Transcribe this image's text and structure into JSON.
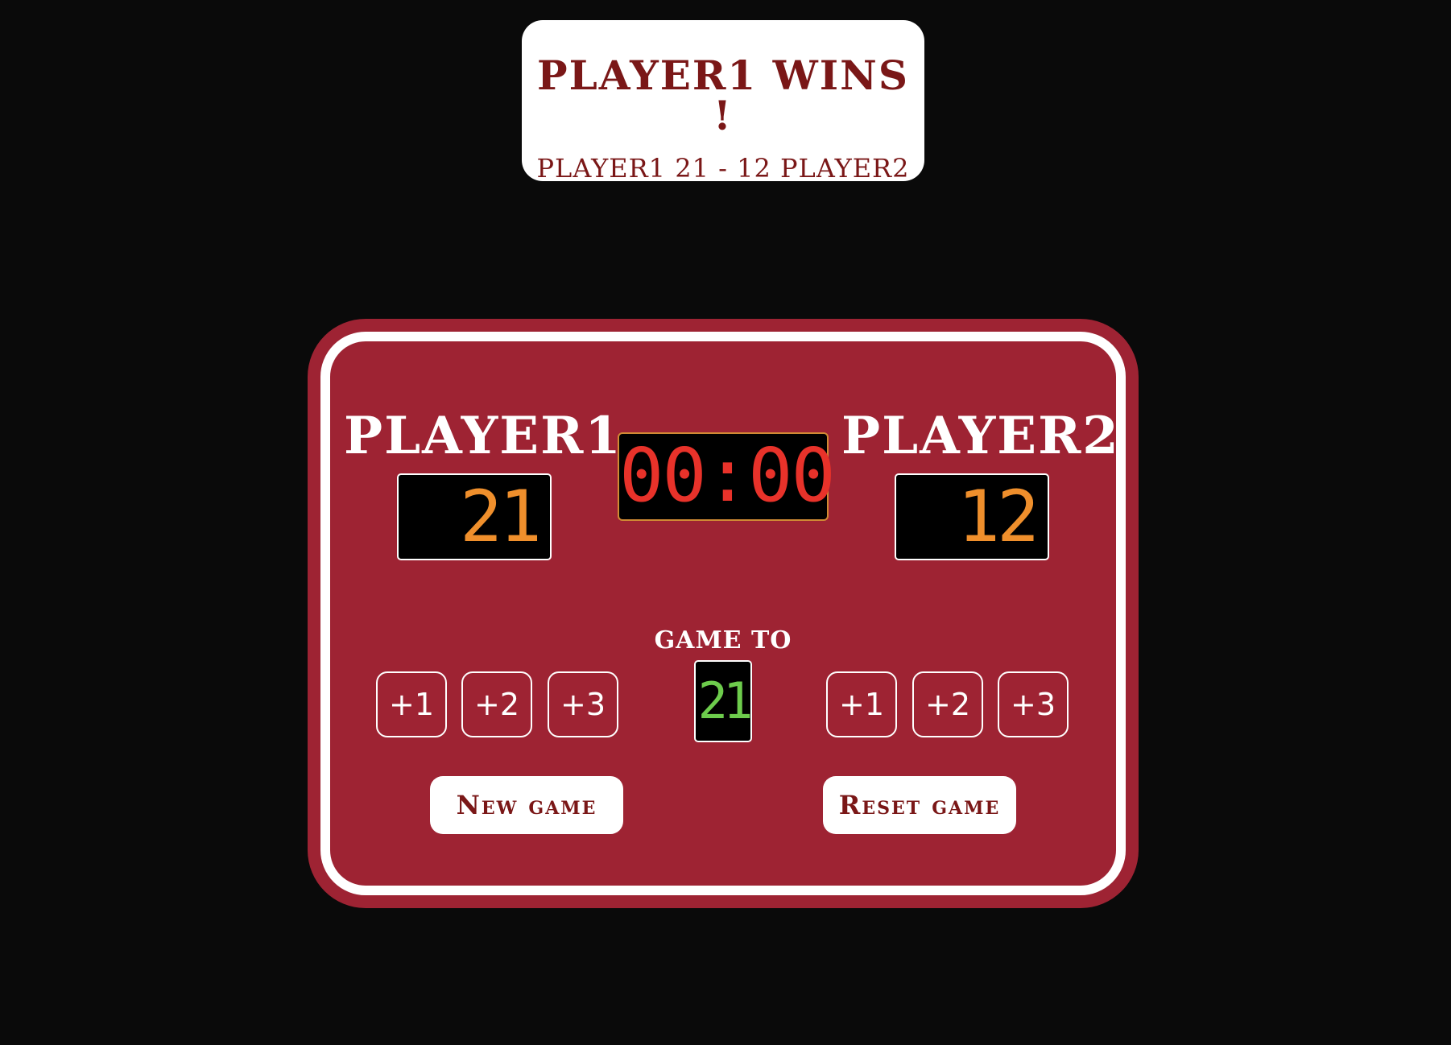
{
  "banner": {
    "title": "PLAYER1 WINS !",
    "score_line": "PLAYER1 21 - 12 PLAYER2"
  },
  "scoreboard": {
    "timer": "00:00",
    "player1": {
      "name": "PLAYER1",
      "score": "21",
      "buttons": [
        "+1",
        "+2",
        "+3"
      ]
    },
    "player2": {
      "name": "PLAYER2",
      "score": "12",
      "buttons": [
        "+1",
        "+2",
        "+3"
      ]
    },
    "game_to": {
      "label": "GAME TO",
      "value": "21"
    },
    "new_game_label": "New game",
    "reset_game_label": "Reset game"
  },
  "colors": {
    "background": "#0a0a0a",
    "board": "#9e2333",
    "banner_text": "#7a1717",
    "score_digits": "#ef8f2c",
    "timer_digits": "#e8322a",
    "target_digits": "#6dcc4c"
  }
}
